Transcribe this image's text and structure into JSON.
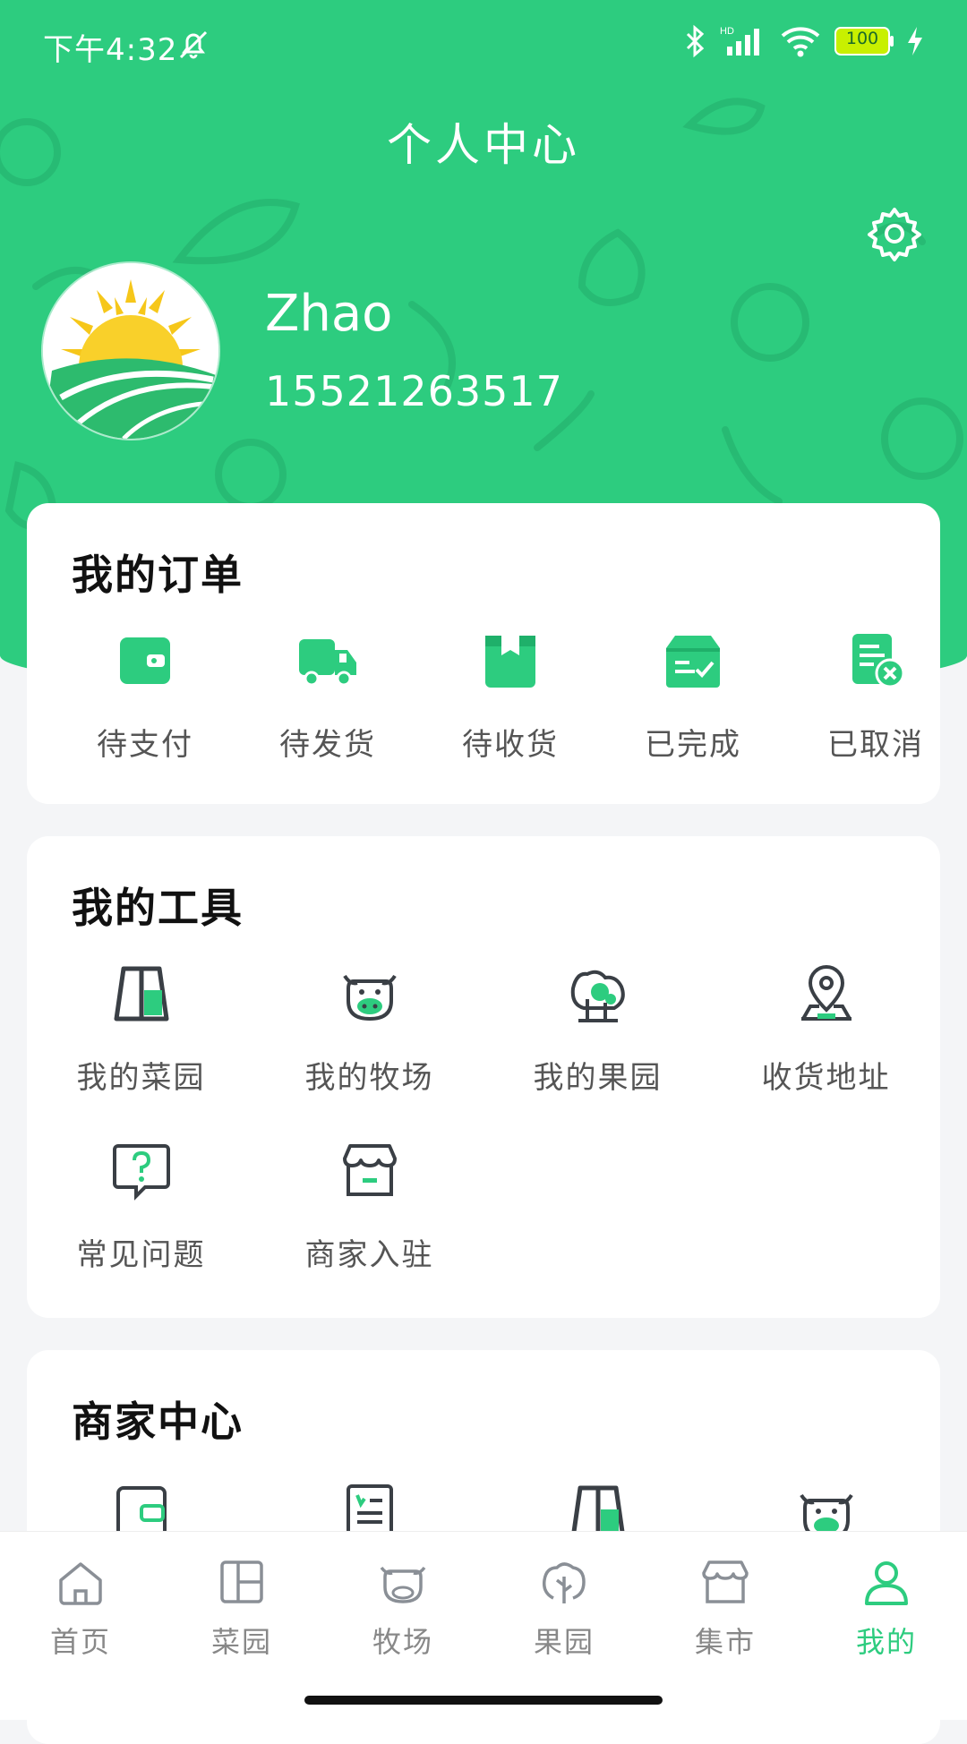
{
  "status_bar": {
    "time": "下午4:32",
    "battery": "100"
  },
  "header": {
    "title": "个人中心"
  },
  "user": {
    "name": "Zhao",
    "phone": "15521263517"
  },
  "orders": {
    "title": "我的订单",
    "items": [
      {
        "label": "待支付",
        "icon": "wallet-icon"
      },
      {
        "label": "待发货",
        "icon": "truck-icon"
      },
      {
        "label": "待收货",
        "icon": "package-icon"
      },
      {
        "label": "已完成",
        "icon": "box-check-icon"
      },
      {
        "label": "已取消",
        "icon": "document-cancel-icon"
      }
    ]
  },
  "tools": {
    "title": "我的工具",
    "items": [
      {
        "label": "我的菜园",
        "icon": "garden-plot-icon"
      },
      {
        "label": "我的牧场",
        "icon": "cow-icon"
      },
      {
        "label": "我的果园",
        "icon": "fruit-tree-icon"
      },
      {
        "label": "收货地址",
        "icon": "location-pin-icon"
      },
      {
        "label": "常见问题",
        "icon": "question-bubble-icon"
      },
      {
        "label": "商家入驻",
        "icon": "storefront-icon"
      }
    ]
  },
  "merchant": {
    "title": "商家中心",
    "items": [
      {
        "icon": "wallet-icon"
      },
      {
        "icon": "invoice-icon"
      },
      {
        "icon": "garden-plot-icon"
      },
      {
        "icon": "cow-icon"
      }
    ]
  },
  "tabbar": {
    "active_index": 5,
    "accent": "#2dcc7f",
    "items": [
      {
        "label": "首页",
        "icon": "home-icon"
      },
      {
        "label": "菜园",
        "icon": "garden-plot-icon"
      },
      {
        "label": "牧场",
        "icon": "cow-icon"
      },
      {
        "label": "果园",
        "icon": "tree-icon"
      },
      {
        "label": "集市",
        "icon": "storefront-icon"
      },
      {
        "label": "我的",
        "icon": "user-icon"
      }
    ]
  },
  "colors": {
    "primary_green": "#2dcc7f",
    "dark_icon": "#3a3f45",
    "background": "#f4f5f7"
  }
}
